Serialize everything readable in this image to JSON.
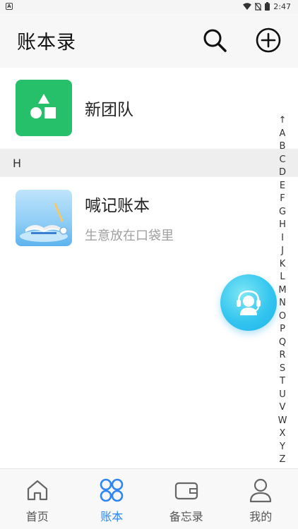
{
  "status_bar": {
    "app_badge": "A",
    "time": "2:47"
  },
  "header": {
    "title": "账本录",
    "search_icon": "search-icon",
    "add_icon": "add-circle-icon"
  },
  "team": {
    "name": "新团队",
    "icon": "shapes-icon",
    "icon_bg": "#26c06b"
  },
  "section": {
    "letter": "H"
  },
  "ledger": {
    "name": "喊记账本",
    "description": "生意放在口袋里"
  },
  "alphabet": [
    "↑",
    "A",
    "B",
    "C",
    "D",
    "E",
    "F",
    "G",
    "H",
    "I",
    "J",
    "K",
    "L",
    "M",
    "N",
    "O",
    "P",
    "Q",
    "R",
    "S",
    "T",
    "U",
    "V",
    "W",
    "X",
    "Y",
    "Z"
  ],
  "nav": {
    "items": [
      {
        "label": "首页",
        "icon": "home-icon"
      },
      {
        "label": "账本",
        "icon": "grid-circles-icon",
        "active": true
      },
      {
        "label": "备忘录",
        "icon": "wallet-icon"
      },
      {
        "label": "我的",
        "icon": "person-icon"
      }
    ]
  },
  "colors": {
    "accent": "#2d86f2",
    "float_button": "#34c6ef"
  }
}
